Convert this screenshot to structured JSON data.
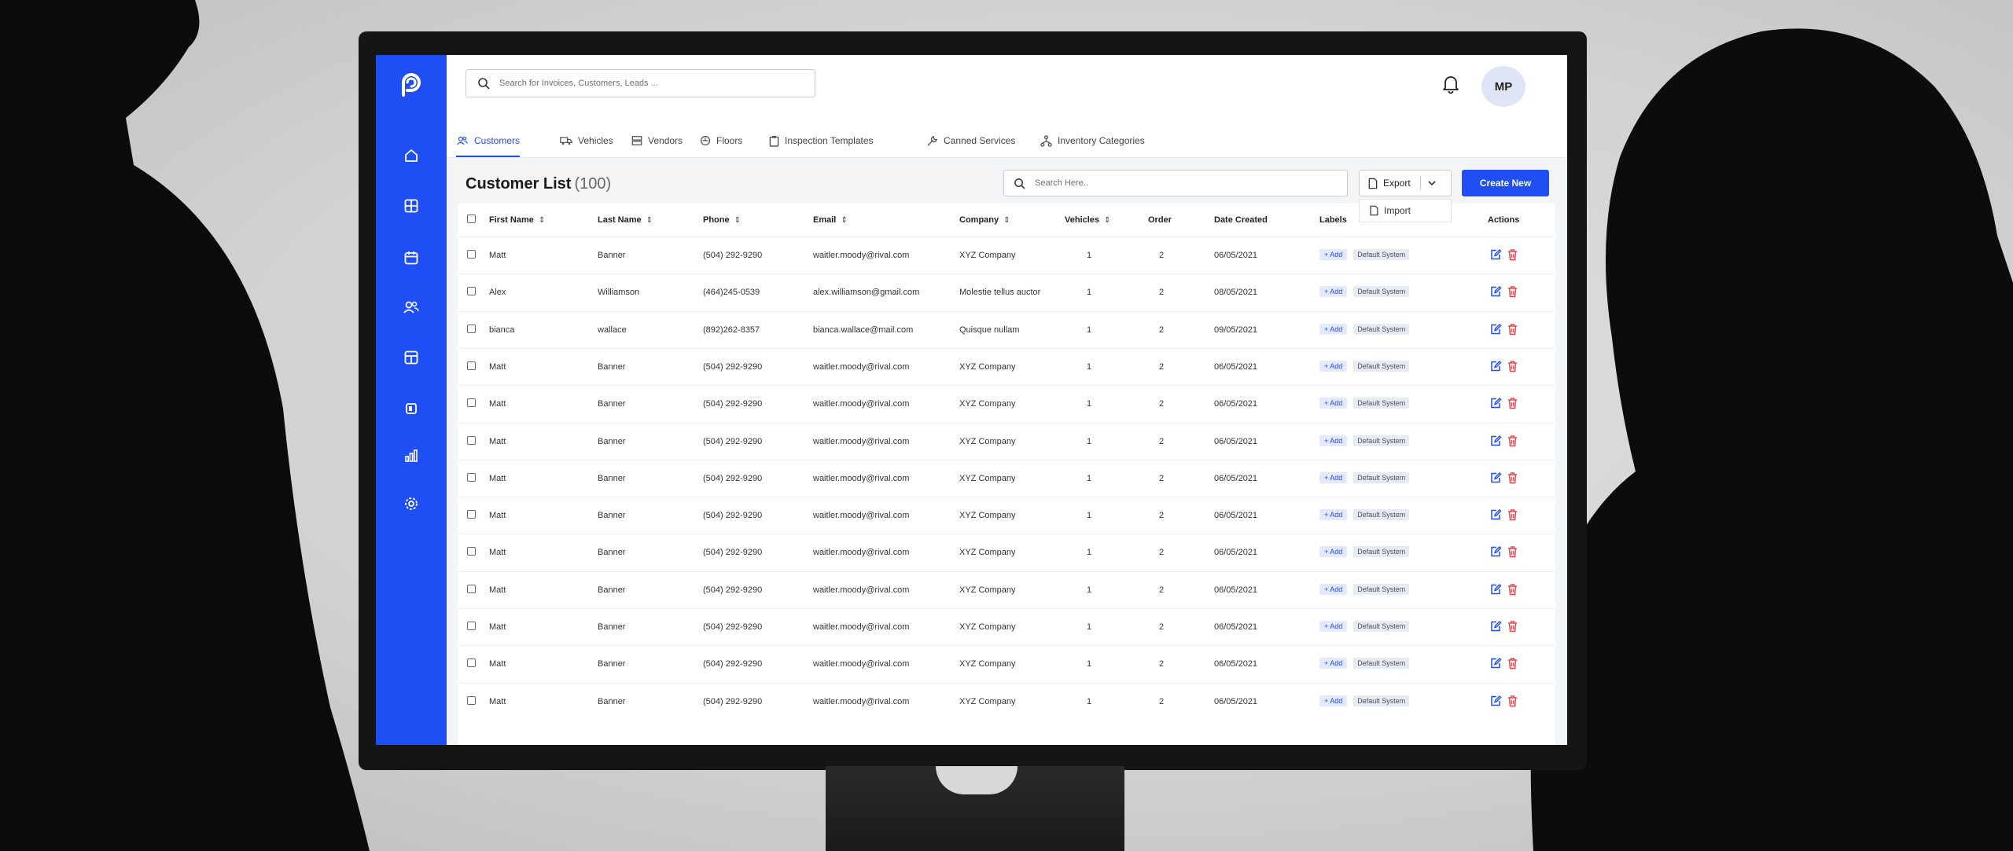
{
  "search": {
    "placeholder": "Search for Invoices, Customers, Leads ..."
  },
  "user": {
    "initials": "MP"
  },
  "sidebar": {
    "items": [
      {
        "icon": "home-icon"
      },
      {
        "icon": "dashboard-grid-icon"
      },
      {
        "icon": "calendar-icon"
      },
      {
        "icon": "users-icon"
      },
      {
        "icon": "inventory-grid-icon"
      },
      {
        "icon": "vehicle-icon"
      },
      {
        "icon": "reports-chart-icon"
      },
      {
        "icon": "settings-gear-icon"
      }
    ]
  },
  "tabs": [
    {
      "label": "Customers",
      "icon": "users-icon",
      "active": true
    },
    {
      "label": "Vehicles",
      "icon": "truck-icon"
    },
    {
      "label": "Vendors",
      "icon": "vendor-icon"
    },
    {
      "label": "Floors",
      "icon": "floors-icon"
    },
    {
      "label": "Inspection Templates",
      "icon": "clipboard-icon"
    },
    {
      "label": "Canned Services",
      "icon": "tools-icon"
    },
    {
      "label": "Inventory Categories",
      "icon": "hierarchy-icon"
    }
  ],
  "list": {
    "title": "Customer List",
    "count": "(100)",
    "search_placeholder": "Search Here..",
    "export_label": "Export",
    "import_label": "Import",
    "create_label": "Create New"
  },
  "table": {
    "headers": {
      "first_name": "First Name",
      "last_name": "Last Name",
      "phone": "Phone",
      "email": "Email",
      "company": "Company",
      "vehicles": "Vehicles",
      "order": "Order",
      "date_created": "Date Created",
      "labels": "Labels",
      "actions": "Actions"
    },
    "add_label": "+ Add",
    "rows": [
      {
        "first": "Matt",
        "last": "Banner",
        "phone": "(504) 292-9290",
        "email": "waitler.moody@rival.com",
        "company": "XYZ Company",
        "vehicles": "1",
        "order": "2",
        "date": "06/05/2021",
        "label": "Default System"
      },
      {
        "first": "Alex",
        "last": "Williamson",
        "phone": "(464)245-0539",
        "email": "alex.williamson@gmail.com",
        "company": "Molestie tellus auctor",
        "vehicles": "1",
        "order": "2",
        "date": "08/05/2021",
        "label": "Default System"
      },
      {
        "first": "bianca",
        "last": "wallace",
        "phone": "(892)262-8357",
        "email": "bianca.wallace@mail.com",
        "company": "Quisque nullam",
        "vehicles": "1",
        "order": "2",
        "date": "09/05/2021",
        "label": "Default System"
      },
      {
        "first": "Matt",
        "last": "Banner",
        "phone": "(504) 292-9290",
        "email": "waitler.moody@rival.com",
        "company": "XYZ Company",
        "vehicles": "1",
        "order": "2",
        "date": "06/05/2021",
        "label": "Default System"
      },
      {
        "first": "Matt",
        "last": "Banner",
        "phone": "(504) 292-9290",
        "email": "waitler.moody@rival.com",
        "company": "XYZ Company",
        "vehicles": "1",
        "order": "2",
        "date": "06/05/2021",
        "label": "Default System"
      },
      {
        "first": "Matt",
        "last": "Banner",
        "phone": "(504) 292-9290",
        "email": "waitler.moody@rival.com",
        "company": "XYZ Company",
        "vehicles": "1",
        "order": "2",
        "date": "06/05/2021",
        "label": "Default System"
      },
      {
        "first": "Matt",
        "last": "Banner",
        "phone": "(504) 292-9290",
        "email": "waitler.moody@rival.com",
        "company": "XYZ Company",
        "vehicles": "1",
        "order": "2",
        "date": "06/05/2021",
        "label": "Default System"
      },
      {
        "first": "Matt",
        "last": "Banner",
        "phone": "(504) 292-9290",
        "email": "waitler.moody@rival.com",
        "company": "XYZ Company",
        "vehicles": "1",
        "order": "2",
        "date": "06/05/2021",
        "label": "Default System"
      },
      {
        "first": "Matt",
        "last": "Banner",
        "phone": "(504) 292-9290",
        "email": "waitler.moody@rival.com",
        "company": "XYZ Company",
        "vehicles": "1",
        "order": "2",
        "date": "06/05/2021",
        "label": "Default System"
      },
      {
        "first": "Matt",
        "last": "Banner",
        "phone": "(504) 292-9290",
        "email": "waitler.moody@rival.com",
        "company": "XYZ Company",
        "vehicles": "1",
        "order": "2",
        "date": "06/05/2021",
        "label": "Default System"
      },
      {
        "first": "Matt",
        "last": "Banner",
        "phone": "(504) 292-9290",
        "email": "waitler.moody@rival.com",
        "company": "XYZ Company",
        "vehicles": "1",
        "order": "2",
        "date": "06/05/2021",
        "label": "Default System"
      },
      {
        "first": "Matt",
        "last": "Banner",
        "phone": "(504) 292-9290",
        "email": "waitler.moody@rival.com",
        "company": "XYZ Company",
        "vehicles": "1",
        "order": "2",
        "date": "06/05/2021",
        "label": "Default System"
      },
      {
        "first": "Matt",
        "last": "Banner",
        "phone": "(504) 292-9290",
        "email": "waitler.moody@rival.com",
        "company": "XYZ Company",
        "vehicles": "1",
        "order": "2",
        "date": "06/05/2021",
        "label": "Default System"
      }
    ]
  },
  "colors": {
    "brand": "#1f4ef5",
    "edit_icon": "#1f4ef5",
    "delete_icon": "#e5484d"
  }
}
